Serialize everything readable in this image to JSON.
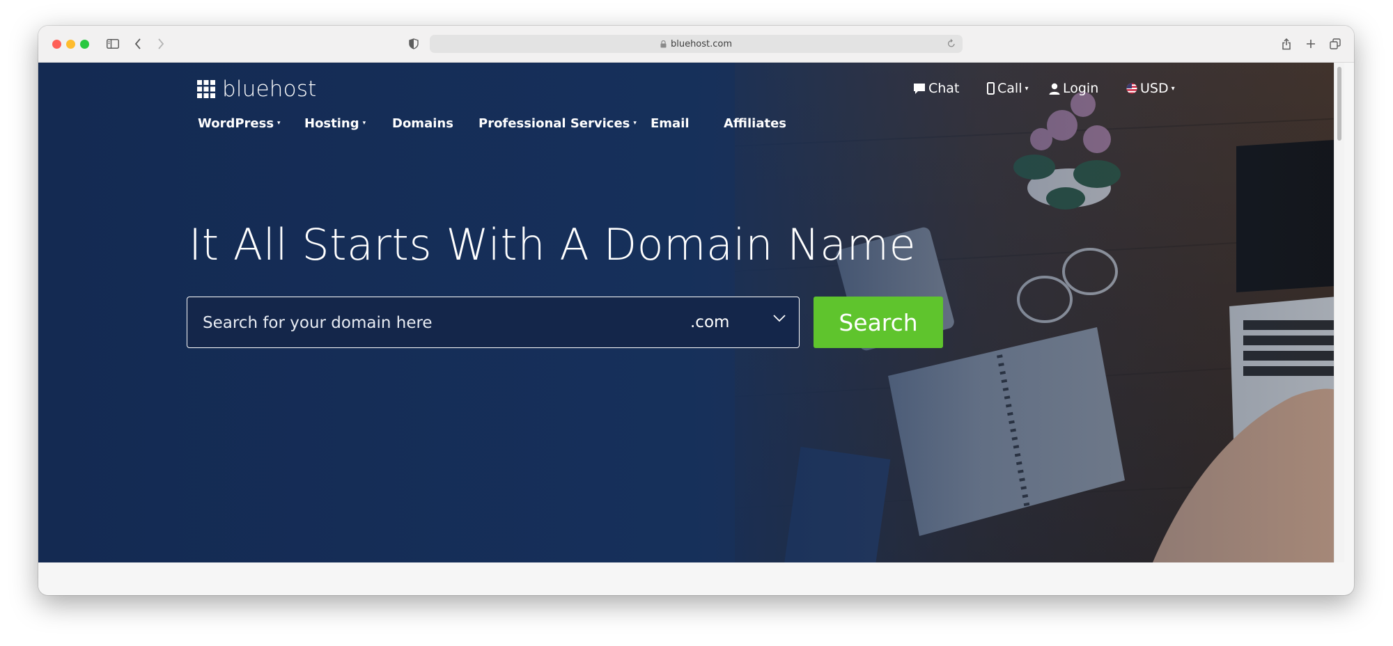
{
  "browser": {
    "url": "bluehost.com",
    "icons": [
      "sidebar-icon",
      "back-icon",
      "forward-icon",
      "privacy-shield-icon",
      "lock-icon",
      "reload-icon",
      "share-icon",
      "new-tab-icon",
      "tab-overview-icon"
    ]
  },
  "site": {
    "logo_text": "bluehost",
    "top_nav": {
      "chat": "Chat",
      "call": "Call",
      "login": "Login",
      "currency": "USD"
    },
    "main_nav": [
      {
        "label": "WordPress",
        "dropdown": true
      },
      {
        "label": "Hosting",
        "dropdown": true
      },
      {
        "label": "Domains",
        "dropdown": false
      },
      {
        "label": "Professional Services",
        "dropdown": true
      },
      {
        "label": "Email",
        "dropdown": false
      },
      {
        "label": "Affiliates",
        "dropdown": false
      }
    ],
    "hero": {
      "headline": "It All Starts With A Domain Name",
      "search_placeholder": "Search for your domain here",
      "tld_selected": ".com",
      "search_button": "Search"
    }
  },
  "colors": {
    "hero_navy": "#172f5a",
    "search_green": "#5fc42d",
    "text_white": "#ffffff"
  }
}
